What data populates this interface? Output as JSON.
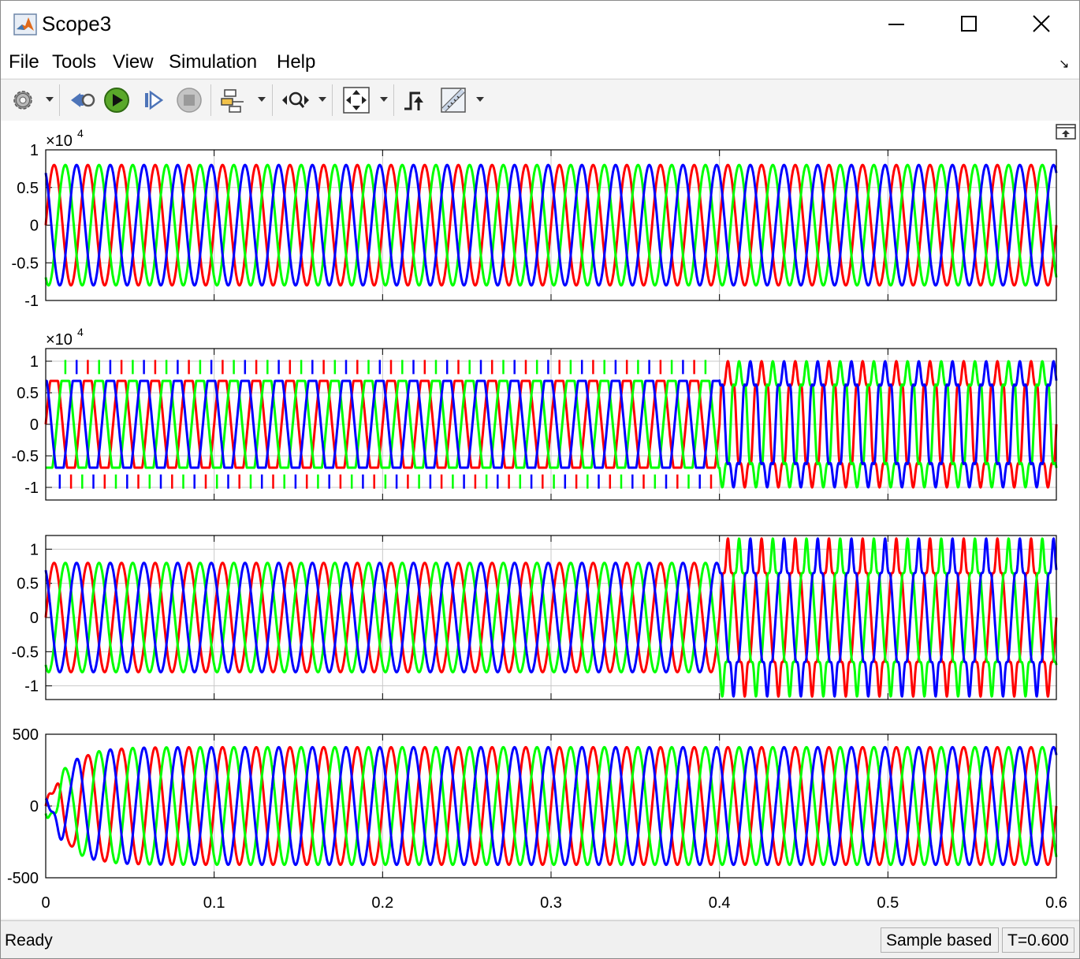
{
  "window": {
    "title": "Scope3"
  },
  "menu": [
    "File",
    "Tools",
    "View",
    "Simulation",
    "Help"
  ],
  "toolbar": {
    "icons": [
      "gear-icon",
      "step-back-icon",
      "run-icon",
      "step-forward-icon",
      "stop-icon",
      "highlight-icon",
      "zoom-icon",
      "autoscale-icon",
      "trigger-icon",
      "measurements-icon"
    ]
  },
  "status": {
    "text": "Ready",
    "sample_mode": "Sample based",
    "time": "T=0.600"
  },
  "colors": {
    "phase_a": "#ff0000",
    "phase_b": "#00ff00",
    "phase_c": "#0000ff",
    "grid": "#c8c8c8"
  },
  "chart_data": [
    {
      "type": "line",
      "x_range": [
        0,
        0.6
      ],
      "y_range": [
        -1,
        1
      ],
      "y_ticks": [
        "1",
        "0.5",
        "0",
        "-0.5",
        "-1"
      ],
      "exponent_label": "×10",
      "exponent": "4",
      "frequency_hz": 50,
      "series": [
        {
          "color": "red",
          "waveform": "sine",
          "amplitude": 0.8,
          "phase_deg": 0
        },
        {
          "color": "green",
          "waveform": "sine",
          "amplitude": 0.8,
          "phase_deg": -120
        },
        {
          "color": "blue",
          "waveform": "sine",
          "amplitude": 0.8,
          "phase_deg": 120
        }
      ]
    },
    {
      "type": "line",
      "x_range": [
        0,
        0.6
      ],
      "y_range": [
        -1.2,
        1.2
      ],
      "y_ticks": [
        "1",
        "0.5",
        "0",
        "-0.5",
        "-1"
      ],
      "exponent_label": "×10",
      "exponent": "4",
      "frequency_hz": 50,
      "event_time": 0.4,
      "series": [
        {
          "color": "red",
          "waveform": "flat-top with spikes, then stepped six-pulse after t=0.4",
          "amplitude_before": 0.8,
          "amplitude_after": 1.0,
          "phase_deg": 0
        },
        {
          "color": "green",
          "waveform": "flat-top with spikes, then stepped six-pulse after t=0.4",
          "amplitude_before": 0.8,
          "amplitude_after": 1.0,
          "phase_deg": -120
        },
        {
          "color": "blue",
          "waveform": "flat-top with spikes, then stepped six-pulse after t=0.4",
          "amplitude_before": 0.8,
          "amplitude_after": 1.0,
          "phase_deg": 120
        }
      ]
    },
    {
      "type": "line",
      "x_range": [
        0,
        0.6
      ],
      "y_range": [
        -1.2,
        1.2
      ],
      "y_ticks": [
        "1",
        "0.5",
        "0",
        "-0.5",
        "-1"
      ],
      "frequency_hz": 50,
      "event_time": 0.4,
      "series": [
        {
          "color": "red",
          "waveform": "sine, distorted after t=0.4",
          "amplitude_before": 0.8,
          "amplitude_after": 0.98,
          "phase_deg": 0
        },
        {
          "color": "green",
          "waveform": "sine, distorted after t=0.4",
          "amplitude_before": 0.8,
          "amplitude_after": 0.98,
          "phase_deg": -120
        },
        {
          "color": "blue",
          "waveform": "sine, distorted after t=0.4",
          "amplitude_before": 0.8,
          "amplitude_after": 0.98,
          "phase_deg": 120
        }
      ]
    },
    {
      "type": "line",
      "x_range": [
        0,
        0.6
      ],
      "y_range": [
        -500,
        500
      ],
      "y_ticks": [
        "500",
        "0",
        "-500"
      ],
      "frequency_hz": 50,
      "x_ticks": [
        "0",
        "0.1",
        "0.2",
        "0.3",
        "0.4",
        "0.5",
        "0.6"
      ],
      "series": [
        {
          "color": "red",
          "waveform": "sine with startup transient",
          "amplitude": 410,
          "phase_deg": 0
        },
        {
          "color": "green",
          "waveform": "sine with startup transient",
          "amplitude": 410,
          "phase_deg": -120
        },
        {
          "color": "blue",
          "waveform": "sine with startup transient",
          "amplitude": 410,
          "phase_deg": 120
        }
      ]
    }
  ]
}
